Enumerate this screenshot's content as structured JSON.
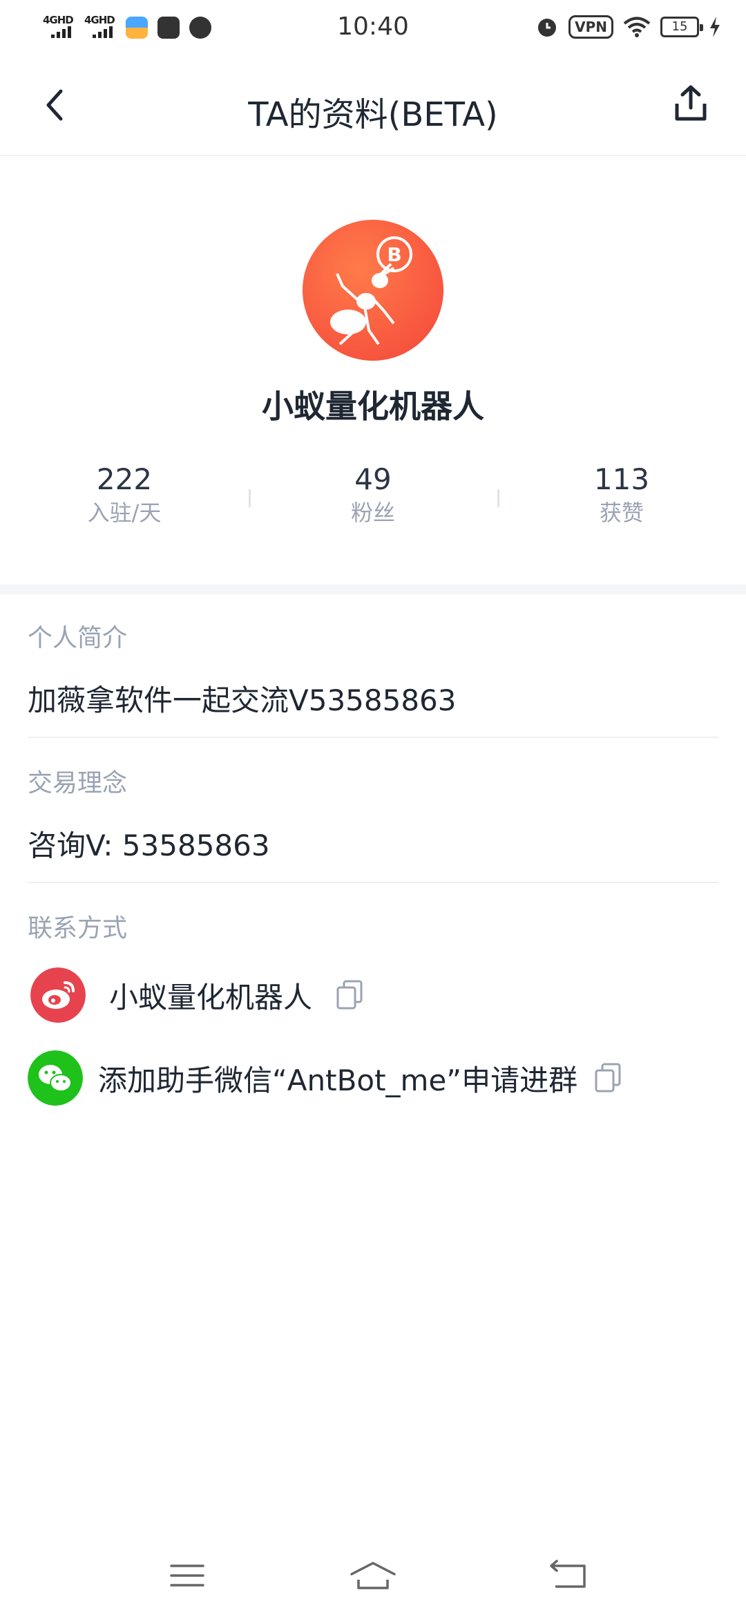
{
  "status_bar": {
    "time": "10:40",
    "signal_1": "4GHD",
    "signal_2": "4GHD",
    "vpn": "VPN",
    "battery": "15"
  },
  "nav": {
    "title": "TA的资料(BETA)"
  },
  "profile": {
    "name": "小蚁量化机器人",
    "stats": [
      {
        "value": "222",
        "label": "入驻/天"
      },
      {
        "value": "49",
        "label": "粉丝"
      },
      {
        "value": "113",
        "label": "获赞"
      }
    ]
  },
  "sections": {
    "bio_title": "个人简介",
    "bio_text": "加薇拿软件一起交流V53585863",
    "philosophy_title": "交易理念",
    "philosophy_text": "咨询V: 53585863",
    "contact_title": "联系方式"
  },
  "contacts": [
    {
      "icon": "weibo-icon",
      "text": "小蚁量化机器人",
      "color": "#e6434e"
    },
    {
      "icon": "wechat-icon",
      "text": "添加助手微信“AntBot_me”申请进群",
      "color": "#1fc11b"
    }
  ]
}
